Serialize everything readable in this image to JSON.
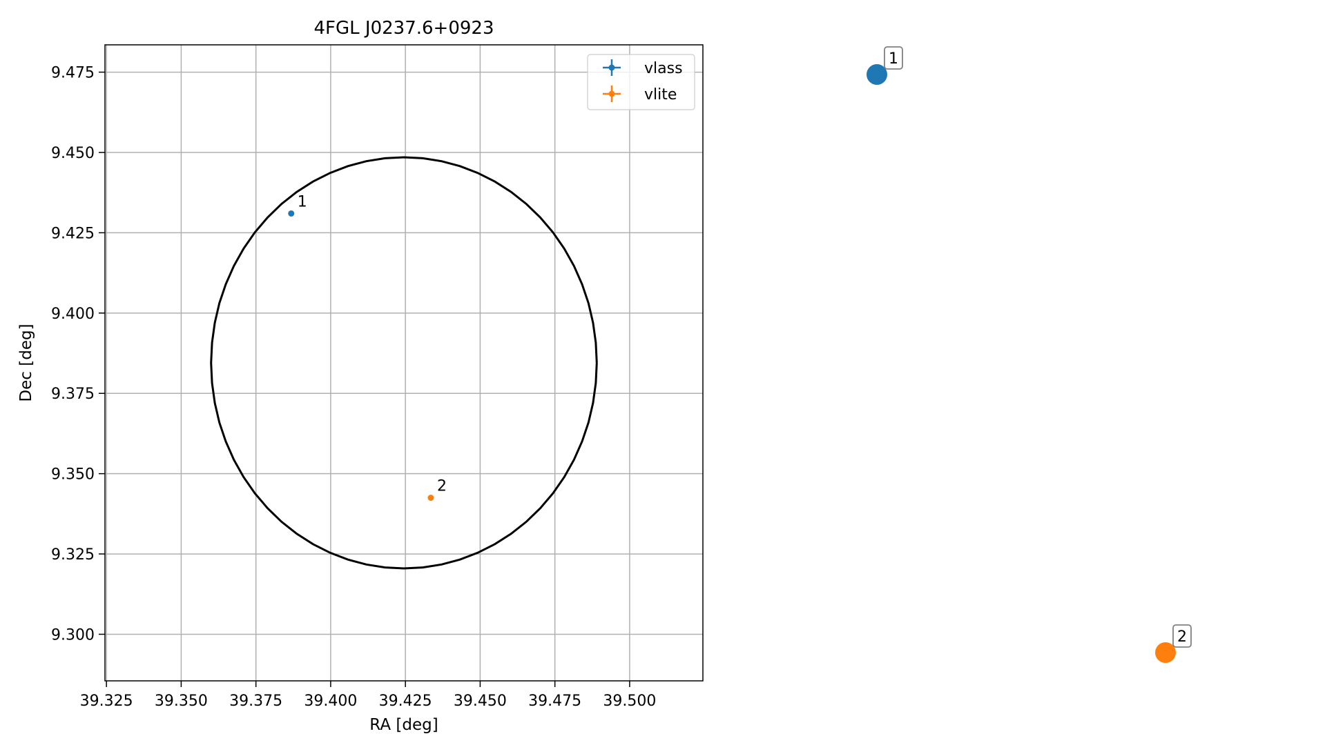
{
  "chart_data": {
    "type": "scatter",
    "title": "4FGL J0237.6+0923",
    "xlabel": "RA [deg]",
    "ylabel": "Dec [deg]",
    "xlim": [
      39.3245,
      39.5245
    ],
    "ylim": [
      9.2855,
      9.4835
    ],
    "xticks": [
      39.325,
      39.35,
      39.375,
      39.4,
      39.425,
      39.45,
      39.475,
      39.5
    ],
    "xtick_labels": [
      "39.325",
      "39.350",
      "39.375",
      "39.400",
      "39.425",
      "39.450",
      "39.475",
      "39.500"
    ],
    "yticks": [
      9.3,
      9.325,
      9.35,
      9.375,
      9.4,
      9.425,
      9.45,
      9.475
    ],
    "ytick_labels": [
      "9.300",
      "9.325",
      "9.350",
      "9.375",
      "9.400",
      "9.425",
      "9.450",
      "9.475"
    ],
    "grid": true,
    "legend": {
      "position": "top-right",
      "entries": [
        "vlass",
        "vlite"
      ]
    },
    "series": [
      {
        "name": "vlass",
        "color": "#1f77b4",
        "points": [
          {
            "x": 39.3868,
            "y": 9.431,
            "label": "1"
          }
        ]
      },
      {
        "name": "vlite",
        "color": "#ff7f0e",
        "points": [
          {
            "x": 39.4335,
            "y": 9.3425,
            "label": "2"
          }
        ]
      }
    ],
    "circle": {
      "center": [
        39.4245,
        9.3845
      ],
      "ra_radius": 0.0645,
      "dec_radius": 0.064,
      "color": "#000000"
    }
  },
  "side_markers": [
    {
      "label": "1",
      "color": "#1f77b4"
    },
    {
      "label": "2",
      "color": "#ff7f0e"
    }
  ]
}
